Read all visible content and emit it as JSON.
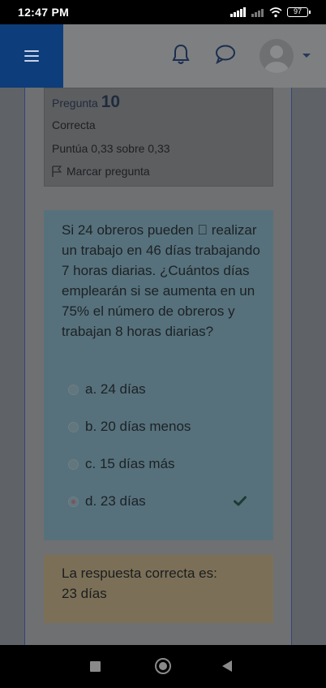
{
  "status_bar": {
    "time": "12:47 PM",
    "battery": "97"
  },
  "header": {
    "icons": [
      "menu-icon",
      "bell-icon",
      "chat-icon",
      "avatar-icon",
      "caret-down-icon"
    ]
  },
  "question_info": {
    "label": "Pregunta",
    "number": "10",
    "state": "Correcta",
    "grade": "Puntúa 0,33 sobre 0,33",
    "flag_label": "Marcar pregunta"
  },
  "question": {
    "text": "Si 24 obreros pueden \u0000 realizar un trabajo en 46 días trabajando 7 horas diarias. ¿Cuántos días emplearán si se aumenta en un 75% el número de obreros y trabajan 8 horas diarias?",
    "options": [
      {
        "label": "a. 24 días",
        "selected": false
      },
      {
        "label": "b. 20 días menos",
        "selected": false
      },
      {
        "label": "c. 15 días más",
        "selected": false
      },
      {
        "label": "d. 23 días",
        "selected": true
      }
    ],
    "selected_index": 3
  },
  "feedback": {
    "correct_label": "La respuesta correcta es:",
    "correct_answer": "23 días"
  },
  "colors": {
    "header_blue": "#0d3d7a",
    "question_bg": "#56717b",
    "feedback_bg": "#7b7057",
    "check": "#1c3b32"
  }
}
